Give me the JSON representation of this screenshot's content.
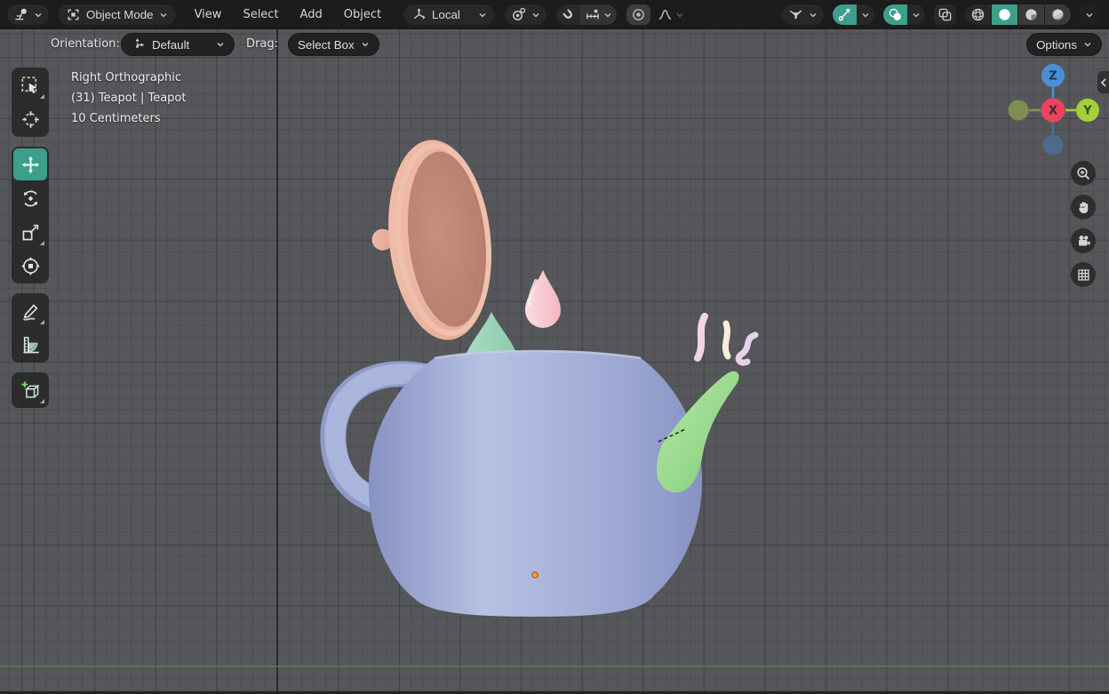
{
  "app_title": "Blender 3D Viewport",
  "header": {
    "editor_type": {
      "icon": "editor-3d-viewport-icon"
    },
    "mode_selector": {
      "icon": "object-mode-icon",
      "label": "Object Mode"
    },
    "menus": [
      {
        "label": "View"
      },
      {
        "label": "Select"
      },
      {
        "label": "Add"
      },
      {
        "label": "Object"
      }
    ],
    "transform_orientation": {
      "icon": "orientation-axes-icon",
      "label": "Local"
    },
    "pivot_point": {
      "icon": "pivot-point-icon"
    },
    "snapping": {
      "magnet_icon": "snap-magnet-icon",
      "target_icon": "snap-increment-icon",
      "enabled": false
    },
    "proportional_editing": {
      "icon": "proportional-editing-icon",
      "falloff_icon": "falloff-curve-icon"
    },
    "object_type_visibility": {
      "icon": "visibility-filter-icon"
    },
    "show_gizmo": {
      "icon": "show-gizmo-icon",
      "enabled": true
    },
    "show_overlays": {
      "icon": "show-overlays-icon",
      "enabled": true
    },
    "toggle_xray": {
      "icon": "xray-icon",
      "enabled": false
    },
    "shading_modes": [
      {
        "name": "wireframe",
        "active": false
      },
      {
        "name": "solid",
        "active": true
      },
      {
        "name": "material-preview",
        "active": false
      },
      {
        "name": "rendered",
        "active": false
      }
    ]
  },
  "tool_settings": {
    "orientation_label": "Orientation:",
    "orientation_value": "Default",
    "drag_label": "Drag:",
    "drag_value": "Select Box",
    "options_label": "Options"
  },
  "toolbar": {
    "tools": [
      {
        "name": "tweak-select-box",
        "active": false,
        "has_subtools": true
      },
      {
        "name": "cursor",
        "active": false,
        "has_subtools": false
      },
      {
        "name": "move",
        "active": true,
        "has_subtools": false
      },
      {
        "name": "rotate",
        "active": false,
        "has_subtools": false
      },
      {
        "name": "scale",
        "active": false,
        "has_subtools": true
      },
      {
        "name": "transform",
        "active": false,
        "has_subtools": false
      },
      {
        "name": "annotate",
        "active": false,
        "has_subtools": true
      },
      {
        "name": "measure",
        "active": false,
        "has_subtools": false
      },
      {
        "name": "add-cube",
        "active": false,
        "has_subtools": true
      }
    ]
  },
  "viewport": {
    "view_name": "Right Orthographic",
    "object_info": "(31) Teapot | Teapot",
    "grid_scale": "10 Centimeters",
    "axis_gizmo": {
      "x_label": "X",
      "y_label": "Y",
      "z_label": "Z"
    },
    "nav_buttons": [
      {
        "name": "zoom"
      },
      {
        "name": "pan"
      },
      {
        "name": "camera-view"
      },
      {
        "name": "toggle-projection"
      }
    ],
    "scene": {
      "selected_object": "Teapot",
      "visible_parts": [
        "body",
        "lid",
        "handle",
        "spout",
        "steam-drop",
        "steam-cone",
        "steam-wisps",
        "origin-point"
      ]
    }
  },
  "colors": {
    "accent": "#3d9e8c",
    "header_bg": "#1c1c1d",
    "pill_bg": "#282828",
    "viewport_bg": "#56575a",
    "text_primary": "#dcdcdc",
    "grid_axis_dark": "#1e1e20",
    "grid_axis_green": "#5e7f52",
    "axis_x_red": "#e8455e",
    "axis_y_green": "#a6ce3a",
    "axis_y_dim": "#85944f",
    "axis_z_blue": "#4a8fd6",
    "axis_z_dim": "#4b6e92",
    "teapot_body_light": "#b7c1e3",
    "teapot_body": "#9da9d3",
    "teapot_body_dark": "#8692c2",
    "handle": "#aab5dc",
    "handle_dark": "#8e9ac8",
    "lid_outer_light": "#f0bfab",
    "lid_outer": "#e3a894",
    "lid_inner": "#c98f7d",
    "lid_inner_dark": "#b17a6a",
    "spout_light": "#b5e7a9",
    "spout": "#96d88b",
    "spout_dark": "#7bc276",
    "cone": "#a9dec3",
    "cone_dark": "#8cc9ab",
    "drop_light": "#fbdde2",
    "drop": "#f3b7c1",
    "wisp_pink": "#f2d4e6",
    "wisp_cream": "#f6eddc",
    "wisp_lilac": "#e8d2ea",
    "origin_orange": "#f0a050",
    "origin_ring": "#c26a24"
  }
}
